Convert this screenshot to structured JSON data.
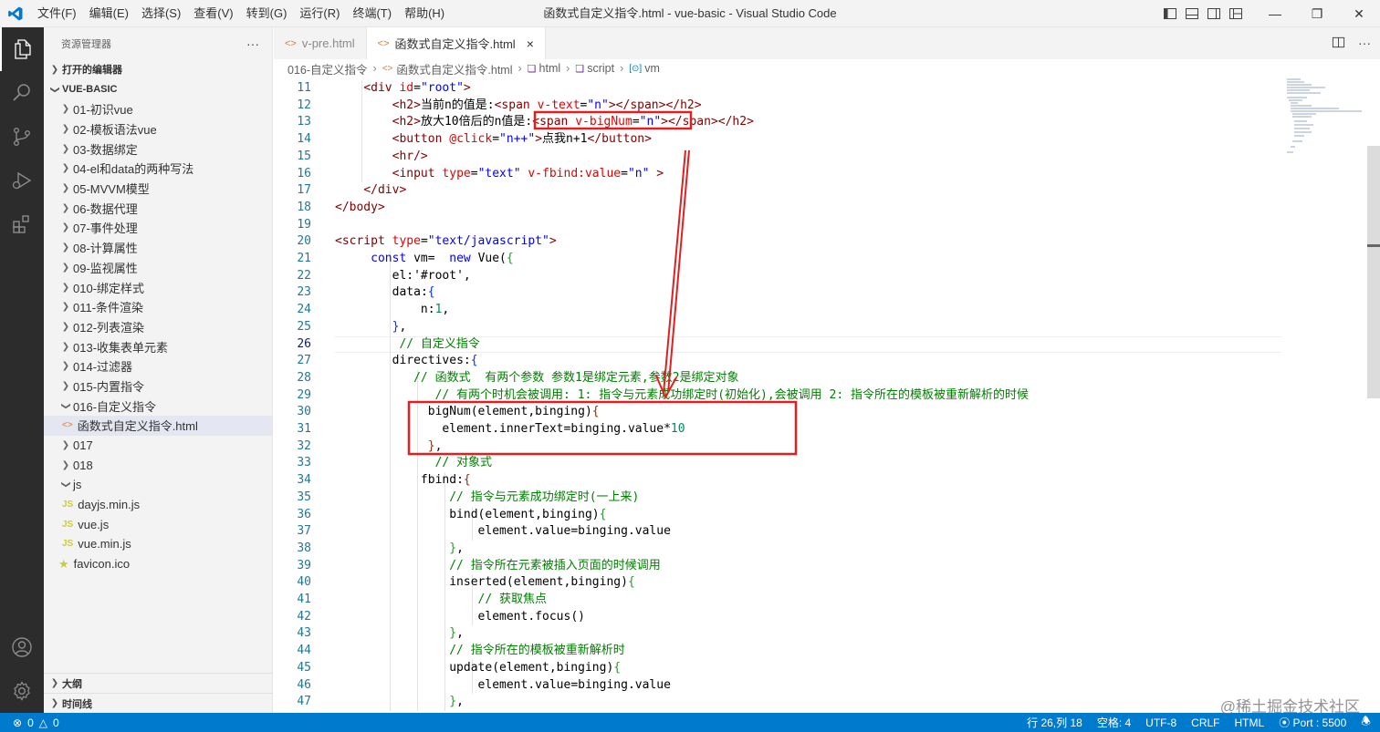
{
  "window": {
    "title": "函数式自定义指令.html - vue-basic - Visual Studio Code",
    "menu": [
      "文件(F)",
      "编辑(E)",
      "选择(S)",
      "查看(V)",
      "转到(G)",
      "运行(R)",
      "终端(T)",
      "帮助(H)"
    ]
  },
  "colors": {
    "accent": "#007acc",
    "annotation": "#e02020"
  },
  "activity_bar": [
    "files-icon",
    "search-icon",
    "source-control-icon",
    "run-debug-icon",
    "extensions-icon"
  ],
  "activity_bottom": [
    "account-icon",
    "manage-gear-icon"
  ],
  "sidebar": {
    "title": "资源管理器",
    "more": "···",
    "open_editors": "打开的编辑器",
    "project": "VUE-BASIC",
    "items": [
      {
        "label": "01-初识vue",
        "type": "folder",
        "depth": 1,
        "open": false
      },
      {
        "label": "02-模板语法vue",
        "type": "folder",
        "depth": 1,
        "open": false
      },
      {
        "label": "03-数据绑定",
        "type": "folder",
        "depth": 1,
        "open": false
      },
      {
        "label": "04-el和data的两种写法",
        "type": "folder",
        "depth": 1,
        "open": false
      },
      {
        "label": "05-MVVM模型",
        "type": "folder",
        "depth": 1,
        "open": false
      },
      {
        "label": "06-数据代理",
        "type": "folder",
        "depth": 1,
        "open": false
      },
      {
        "label": "07-事件处理",
        "type": "folder",
        "depth": 1,
        "open": false
      },
      {
        "label": "08-计算属性",
        "type": "folder",
        "depth": 1,
        "open": false
      },
      {
        "label": "09-监视属性",
        "type": "folder",
        "depth": 1,
        "open": false
      },
      {
        "label": "010-绑定样式",
        "type": "folder",
        "depth": 1,
        "open": false
      },
      {
        "label": "011-条件渲染",
        "type": "folder",
        "depth": 1,
        "open": false
      },
      {
        "label": "012-列表渲染",
        "type": "folder",
        "depth": 1,
        "open": false
      },
      {
        "label": "013-收集表单元素",
        "type": "folder",
        "depth": 1,
        "open": false
      },
      {
        "label": "014-过滤器",
        "type": "folder",
        "depth": 1,
        "open": false
      },
      {
        "label": "015-内置指令",
        "type": "folder",
        "depth": 1,
        "open": false
      },
      {
        "label": "016-自定义指令",
        "type": "folder",
        "depth": 1,
        "open": true
      },
      {
        "label": "函数式自定义指令.html",
        "type": "html",
        "depth": 2,
        "selected": true
      },
      {
        "label": "017",
        "type": "folder",
        "depth": 1,
        "open": false
      },
      {
        "label": "018",
        "type": "folder",
        "depth": 1,
        "open": false
      },
      {
        "label": "js",
        "type": "folder",
        "depth": 1,
        "open": true
      },
      {
        "label": "dayjs.min.js",
        "type": "js",
        "depth": 2
      },
      {
        "label": "vue.js",
        "type": "js",
        "depth": 2
      },
      {
        "label": "vue.min.js",
        "type": "js",
        "depth": 2
      },
      {
        "label": "favicon.ico",
        "type": "ico",
        "depth": 1
      }
    ],
    "outline": "大纲",
    "timeline": "时间线"
  },
  "tabs": [
    {
      "label": "v-pre.html",
      "active": false
    },
    {
      "label": "函数式自定义指令.html",
      "active": true,
      "close": "×"
    }
  ],
  "breadcrumb": [
    "016-自定义指令",
    "函数式自定义指令.html",
    "html",
    "script",
    "vm"
  ],
  "editor": {
    "current_line": 26,
    "lines": [
      {
        "n": 11,
        "tokens": [
          [
            "    ",
            "pl"
          ],
          [
            "<div ",
            "tg"
          ],
          [
            "id",
            "at"
          ],
          [
            "=",
            "pl"
          ],
          [
            "\"root\"",
            "st"
          ],
          [
            ">",
            "tg"
          ]
        ]
      },
      {
        "n": 12,
        "tokens": [
          [
            "        ",
            "pl"
          ],
          [
            "<h2>",
            "tg"
          ],
          [
            "当前n的值是:",
            "pl"
          ],
          [
            "<span ",
            "tg"
          ],
          [
            "v-text",
            "at"
          ],
          [
            "=",
            "pl"
          ],
          [
            "\"n\"",
            "st"
          ],
          [
            "></span></h2>",
            "tg"
          ]
        ]
      },
      {
        "n": 13,
        "tokens": [
          [
            "        ",
            "pl"
          ],
          [
            "<h2>",
            "tg"
          ],
          [
            "放大10倍后的n值是:",
            "pl"
          ],
          [
            "<span ",
            "tg"
          ],
          [
            "v-bigNum",
            "at"
          ],
          [
            "=",
            "pl"
          ],
          [
            "\"n\"",
            "st"
          ],
          [
            "></span></h2>",
            "tg"
          ]
        ]
      },
      {
        "n": 14,
        "tokens": [
          [
            "        ",
            "pl"
          ],
          [
            "<button ",
            "tg"
          ],
          [
            "@click",
            "at"
          ],
          [
            "=",
            "pl"
          ],
          [
            "\"n++\"",
            "st"
          ],
          [
            ">",
            "tg"
          ],
          [
            "点我n+1",
            "pl"
          ],
          [
            "</button>",
            "tg"
          ]
        ]
      },
      {
        "n": 15,
        "tokens": [
          [
            "        ",
            "pl"
          ],
          [
            "<hr/>",
            "tg"
          ]
        ]
      },
      {
        "n": 16,
        "tokens": [
          [
            "        ",
            "pl"
          ],
          [
            "<input ",
            "tg"
          ],
          [
            "type",
            "at"
          ],
          [
            "=",
            "pl"
          ],
          [
            "\"text\"",
            "st"
          ],
          [
            " ",
            "pl"
          ],
          [
            "v-fbind:value",
            "at"
          ],
          [
            "=",
            "pl"
          ],
          [
            "\"n\"",
            "st"
          ],
          [
            " >",
            "tg"
          ]
        ]
      },
      {
        "n": 17,
        "tokens": [
          [
            "    ",
            "pl"
          ],
          [
            "</div>",
            "tg"
          ]
        ]
      },
      {
        "n": 18,
        "tokens": [
          [
            "</body>",
            "tg"
          ]
        ]
      },
      {
        "n": 19,
        "tokens": []
      },
      {
        "n": 20,
        "tokens": [
          [
            "<script ",
            "tg"
          ],
          [
            "type",
            "at"
          ],
          [
            "=",
            "pl"
          ],
          [
            "\"text/javascript\"",
            "st"
          ],
          [
            ">",
            "tg"
          ]
        ]
      },
      {
        "n": 21,
        "tokens": [
          [
            "     ",
            "pl"
          ],
          [
            "const ",
            "kw"
          ],
          [
            "vm",
            "pl"
          ],
          [
            "=  ",
            "pl"
          ],
          [
            "new ",
            "kw"
          ],
          [
            "Vue",
            "pl"
          ],
          [
            "(",
            "pl"
          ],
          [
            "{",
            "br2"
          ]
        ]
      },
      {
        "n": 22,
        "tokens": [
          [
            "        ",
            "pl"
          ],
          [
            "el",
            "pl"
          ],
          [
            ":",
            "pl"
          ],
          [
            "'#root'",
            "pl"
          ],
          [
            ",",
            "pl"
          ]
        ]
      },
      {
        "n": 23,
        "tokens": [
          [
            "        ",
            "pl"
          ],
          [
            "data",
            "pl"
          ],
          [
            ":",
            "pl"
          ],
          [
            "{",
            "br"
          ]
        ]
      },
      {
        "n": 24,
        "tokens": [
          [
            "            ",
            "pl"
          ],
          [
            "n",
            "pl"
          ],
          [
            ":",
            "pl"
          ],
          [
            "1",
            "nm"
          ],
          [
            ",",
            "pl"
          ]
        ]
      },
      {
        "n": 25,
        "tokens": [
          [
            "        ",
            "pl"
          ],
          [
            "}",
            "br"
          ],
          [
            ",",
            "pl"
          ]
        ]
      },
      {
        "n": 26,
        "tokens": [
          [
            "         ",
            "pl"
          ],
          [
            "// 自定义指令",
            "cm"
          ]
        ]
      },
      {
        "n": 27,
        "tokens": [
          [
            "        ",
            "pl"
          ],
          [
            "directives",
            "pl"
          ],
          [
            ":",
            "pl"
          ],
          [
            "{",
            "br"
          ]
        ]
      },
      {
        "n": 28,
        "tokens": [
          [
            "           ",
            "pl"
          ],
          [
            "// 函数式  有两个参数 参数1是绑定元素,参数2是绑定对象",
            "cm"
          ]
        ]
      },
      {
        "n": 29,
        "tokens": [
          [
            "              ",
            "pl"
          ],
          [
            "// 有两个时机会被调用: 1: 指令与元素成功绑定时(初始化),会被调用 2: 指令所在的模板被重新解析的时候",
            "cm"
          ]
        ]
      },
      {
        "n": 30,
        "tokens": [
          [
            "             ",
            "pl"
          ],
          [
            "bigNum",
            "pl"
          ],
          [
            "(",
            "pl"
          ],
          [
            "element",
            "pl"
          ],
          [
            ",",
            "pl"
          ],
          [
            "binging",
            "pl"
          ],
          [
            ")",
            "pl"
          ],
          [
            "{",
            "br3"
          ]
        ]
      },
      {
        "n": 31,
        "tokens": [
          [
            "               ",
            "pl"
          ],
          [
            "element",
            "pl"
          ],
          [
            ".",
            "pl"
          ],
          [
            "innerText",
            "pl"
          ],
          [
            "=",
            "pl"
          ],
          [
            "binging",
            "pl"
          ],
          [
            ".",
            "pl"
          ],
          [
            "value",
            "pl"
          ],
          [
            "*",
            "pl"
          ],
          [
            "10",
            "nm"
          ]
        ]
      },
      {
        "n": 32,
        "tokens": [
          [
            "             ",
            "pl"
          ],
          [
            "}",
            "br3"
          ],
          [
            ",",
            "pl"
          ]
        ]
      },
      {
        "n": 33,
        "tokens": [
          [
            "              ",
            "pl"
          ],
          [
            "// 对象式",
            "cm"
          ]
        ]
      },
      {
        "n": 34,
        "tokens": [
          [
            "            ",
            "pl"
          ],
          [
            "fbind",
            "pl"
          ],
          [
            ":",
            "pl"
          ],
          [
            "{",
            "br3"
          ]
        ]
      },
      {
        "n": 35,
        "tokens": [
          [
            "                ",
            "pl"
          ],
          [
            "// 指令与元素成功绑定时(一上来)",
            "cm"
          ]
        ]
      },
      {
        "n": 36,
        "tokens": [
          [
            "                ",
            "pl"
          ],
          [
            "bind",
            "pl"
          ],
          [
            "(",
            "pl"
          ],
          [
            "element",
            "pl"
          ],
          [
            ",",
            "pl"
          ],
          [
            "binging",
            "pl"
          ],
          [
            ")",
            "pl"
          ],
          [
            "{",
            "br2"
          ]
        ]
      },
      {
        "n": 37,
        "tokens": [
          [
            "                    ",
            "pl"
          ],
          [
            "element",
            "pl"
          ],
          [
            ".",
            "pl"
          ],
          [
            "value",
            "pl"
          ],
          [
            "=",
            "pl"
          ],
          [
            "binging",
            "pl"
          ],
          [
            ".",
            "pl"
          ],
          [
            "value",
            "pl"
          ]
        ]
      },
      {
        "n": 38,
        "tokens": [
          [
            "                ",
            "pl"
          ],
          [
            "}",
            "br2"
          ],
          [
            ",",
            "pl"
          ]
        ]
      },
      {
        "n": 39,
        "tokens": [
          [
            "                ",
            "pl"
          ],
          [
            "// 指令所在元素被插入页面的时候调用",
            "cm"
          ]
        ]
      },
      {
        "n": 40,
        "tokens": [
          [
            "                ",
            "pl"
          ],
          [
            "inserted",
            "pl"
          ],
          [
            "(",
            "pl"
          ],
          [
            "element",
            "pl"
          ],
          [
            ",",
            "pl"
          ],
          [
            "binging",
            "pl"
          ],
          [
            ")",
            "pl"
          ],
          [
            "{",
            "br2"
          ]
        ]
      },
      {
        "n": 41,
        "tokens": [
          [
            "                    ",
            "pl"
          ],
          [
            "// 获取焦点",
            "cm"
          ]
        ]
      },
      {
        "n": 42,
        "tokens": [
          [
            "                    ",
            "pl"
          ],
          [
            "element",
            "pl"
          ],
          [
            ".",
            "pl"
          ],
          [
            "focus",
            "pl"
          ],
          [
            "()",
            "pl"
          ]
        ]
      },
      {
        "n": 43,
        "tokens": [
          [
            "                ",
            "pl"
          ],
          [
            "}",
            "br2"
          ],
          [
            ",",
            "pl"
          ]
        ]
      },
      {
        "n": 44,
        "tokens": [
          [
            "                ",
            "pl"
          ],
          [
            "// 指令所在的模板被重新解析时",
            "cm"
          ]
        ]
      },
      {
        "n": 45,
        "tokens": [
          [
            "                ",
            "pl"
          ],
          [
            "update",
            "pl"
          ],
          [
            "(",
            "pl"
          ],
          [
            "element",
            "pl"
          ],
          [
            ",",
            "pl"
          ],
          [
            "binging",
            "pl"
          ],
          [
            ")",
            "pl"
          ],
          [
            "{",
            "br2"
          ]
        ]
      },
      {
        "n": 46,
        "tokens": [
          [
            "                    ",
            "pl"
          ],
          [
            "element",
            "pl"
          ],
          [
            ".",
            "pl"
          ],
          [
            "value",
            "pl"
          ],
          [
            "=",
            "pl"
          ],
          [
            "binging",
            "pl"
          ],
          [
            ".",
            "pl"
          ],
          [
            "value",
            "pl"
          ]
        ]
      },
      {
        "n": 47,
        "tokens": [
          [
            "                ",
            "pl"
          ],
          [
            "}",
            "br2"
          ],
          [
            ",",
            "pl"
          ]
        ]
      }
    ]
  },
  "statusbar": {
    "errors": "0",
    "warnings": "0",
    "position": "行 26,列 18",
    "spaces": "空格: 4",
    "encoding": "UTF-8",
    "eol": "CRLF",
    "language": "HTML",
    "port": "Port : 5500"
  },
  "watermark": "@稀土掘金技术社区"
}
